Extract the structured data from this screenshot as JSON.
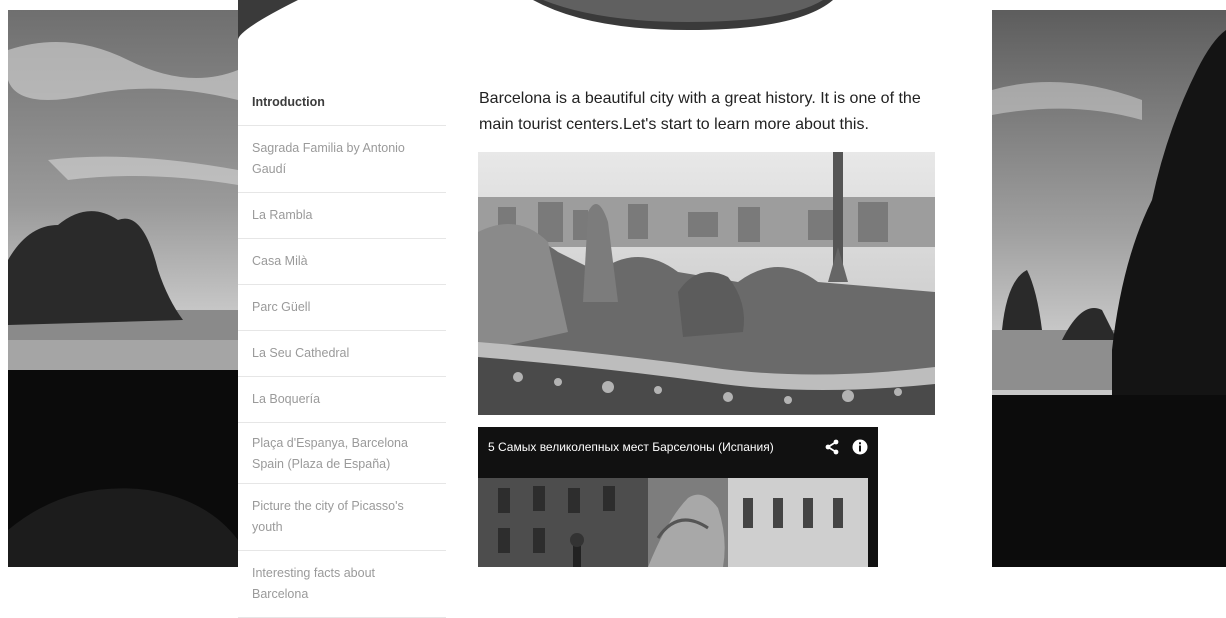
{
  "nav": {
    "items": [
      {
        "label": "Introduction",
        "active": true
      },
      {
        "label": "Sagrada Familia by Antonio Gaudí",
        "active": false
      },
      {
        "label": "La Rambla",
        "active": false
      },
      {
        "label": "Casa Milà",
        "active": false
      },
      {
        "label": "Parc Güell",
        "active": false
      },
      {
        "label": "La Seu Cathedral",
        "active": false
      },
      {
        "label": "La Boquería",
        "active": false
      },
      {
        "label": "Plaça d'Espanya, Barcelona Spain (Plaza de España)",
        "active": false
      },
      {
        "label": "Picture the city of Picasso's youth",
        "active": false
      },
      {
        "label": "Interesting facts about Barcelona",
        "active": false
      }
    ]
  },
  "main": {
    "intro_text": "Barcelona is a beautiful city with  a great history. It is one of the main tourist centers.Let's start to learn more about this."
  },
  "video": {
    "title": "5 Самых великолепных мест Барселоны (Испания)",
    "share_icon": "share-icon",
    "info_icon": "info-icon"
  }
}
